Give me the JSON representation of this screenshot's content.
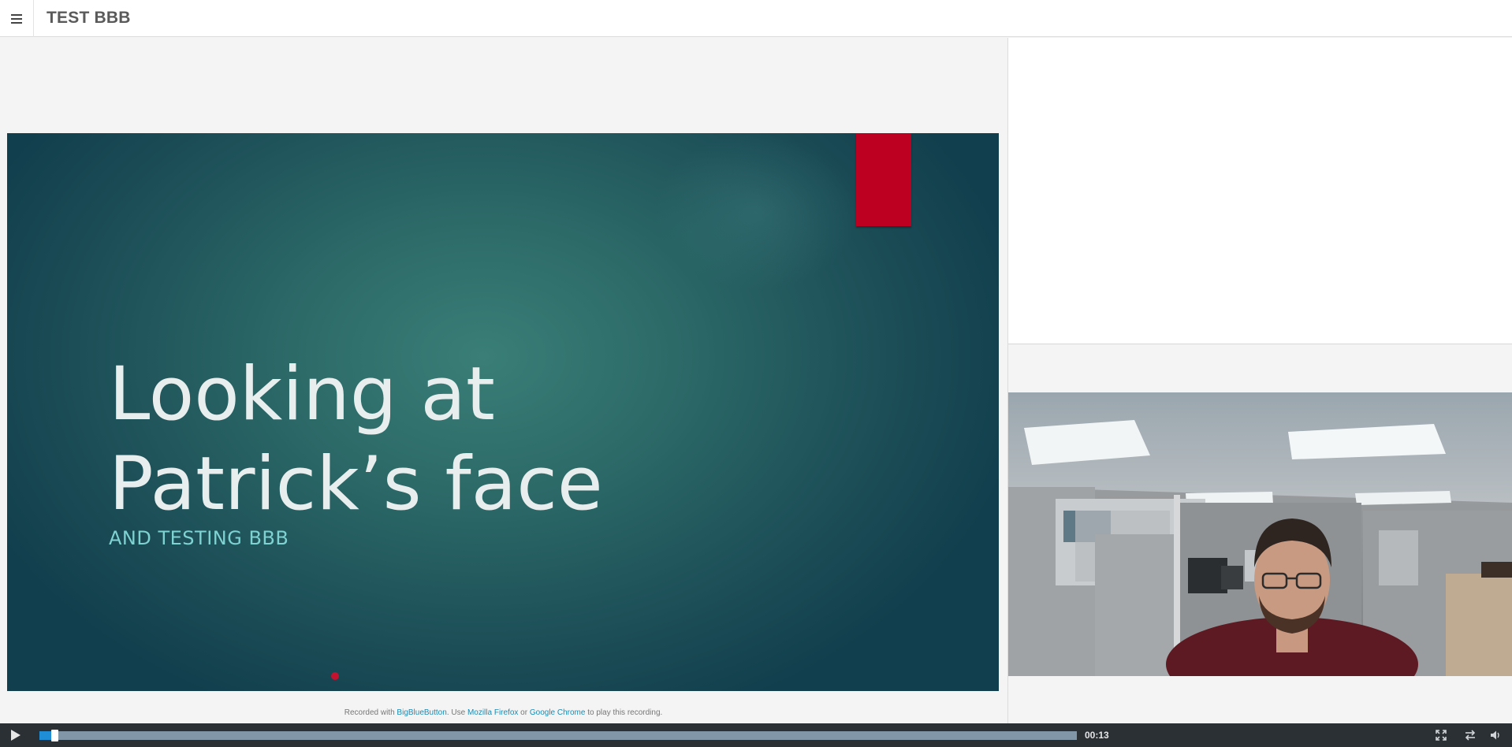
{
  "header": {
    "title": "TEST BBB",
    "menu_icon": "hamburger-menu-icon"
  },
  "slide": {
    "heading": "Looking at\nPatrick’s face",
    "subheading": "AND TESTING BBB",
    "accent_color": "#bd0021",
    "background_color": "#2c6a68"
  },
  "footer": {
    "prefix": "Recorded with ",
    "link1": "BigBlueButton",
    "middle": ". Use ",
    "link2": "Mozilla Firefox",
    "or": " or ",
    "link3": "Google Chrome",
    "suffix": " to play this recording."
  },
  "player": {
    "play_icon": "play-icon",
    "progress_fraction": 0.013,
    "current_time": "00:13",
    "fullscreen_icon": "fullscreen-icon",
    "swap_icon": "swap-icon",
    "volume_icon": "volume-icon",
    "progress_color": "#1f8ed6"
  }
}
